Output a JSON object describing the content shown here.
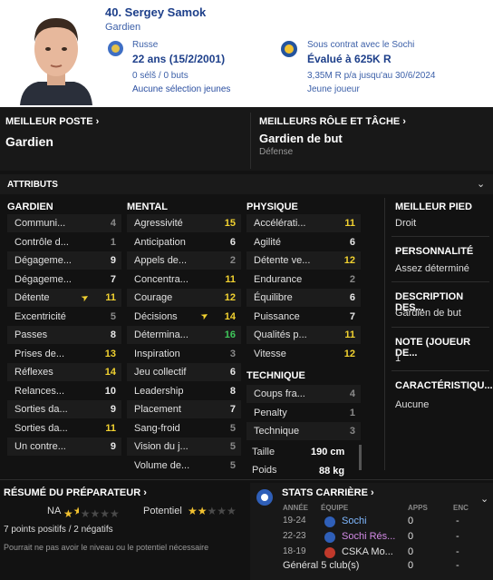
{
  "player": {
    "name": "40. Sergey Samok",
    "position": "Gardien",
    "nationality": "Russe",
    "age": "22 ans (15/2/2001)",
    "selections": "0 sélš / 0 buts",
    "youth": "Aucune sélection jeunes",
    "contract": "Sous contrat avec le Sochi",
    "value": "Évalué à 625K R",
    "wage": "3,35M R p/a jusqu'au 30/6/2024",
    "status": "Jeune joueur"
  },
  "best_position": {
    "label": "MEILLEUR POSTE",
    "value": "Gardien"
  },
  "best_role": {
    "label": "MEILLEURS RÔLE ET TÂCHE",
    "value": "Gardien de but",
    "duty": "Défense"
  },
  "attributes": {
    "title": "ATTRIBUTS",
    "gardien": {
      "title": "GARDIEN",
      "items": [
        {
          "name": "Communi...",
          "value": "4"
        },
        {
          "name": "Contrôle d...",
          "value": "1"
        },
        {
          "name": "Dégageme...",
          "value": "9"
        },
        {
          "name": "Dégageme...",
          "value": "7"
        },
        {
          "name": "Détente",
          "value": "11"
        },
        {
          "name": "Excentricité",
          "value": "5"
        },
        {
          "name": "Passes",
          "value": "8"
        },
        {
          "name": "Prises de...",
          "value": "13"
        },
        {
          "name": "Réflexes",
          "value": "14"
        },
        {
          "name": "Relances...",
          "value": "10"
        },
        {
          "name": "Sorties da...",
          "value": "9"
        },
        {
          "name": "Sorties da...",
          "value": "11"
        },
        {
          "name": "Un contre...",
          "value": "9"
        }
      ]
    },
    "mental": {
      "title": "MENTAL",
      "items": [
        {
          "name": "Agressivité",
          "value": "15"
        },
        {
          "name": "Anticipation",
          "value": "6"
        },
        {
          "name": "Appels de...",
          "value": "2"
        },
        {
          "name": "Concentra...",
          "value": "11"
        },
        {
          "name": "Courage",
          "value": "12"
        },
        {
          "name": "Décisions",
          "value": "14"
        },
        {
          "name": "Détermina...",
          "value": "16"
        },
        {
          "name": "Inspiration",
          "value": "3"
        },
        {
          "name": "Jeu collectif",
          "value": "6"
        },
        {
          "name": "Leadership",
          "value": "8"
        },
        {
          "name": "Placement",
          "value": "7"
        },
        {
          "name": "Sang-froid",
          "value": "5"
        },
        {
          "name": "Vision du j...",
          "value": "5"
        },
        {
          "name": "Volume de...",
          "value": "5"
        }
      ]
    },
    "physique": {
      "title": "PHYSIQUE",
      "items": [
        {
          "name": "Accélérati...",
          "value": "11"
        },
        {
          "name": "Agilité",
          "value": "6"
        },
        {
          "name": "Détente ve...",
          "value": "12"
        },
        {
          "name": "Endurance",
          "value": "2"
        },
        {
          "name": "Équilibre",
          "value": "6"
        },
        {
          "name": "Puissance",
          "value": "7"
        },
        {
          "name": "Qualités p...",
          "value": "11"
        },
        {
          "name": "Vitesse",
          "value": "12"
        }
      ]
    },
    "technique": {
      "title": "TECHNIQUE",
      "items": [
        {
          "name": "Coups fra...",
          "value": "4"
        },
        {
          "name": "Penalty",
          "value": "1"
        },
        {
          "name": "Technique",
          "value": "3"
        }
      ]
    },
    "height_label": "Taille",
    "height": "190 cm",
    "weight_label": "Poids",
    "weight": "88 kg"
  },
  "side": {
    "foot_label": "MEILLEUR PIED",
    "foot": "Droit",
    "pers_label": "PERSONNALITÉ",
    "pers": "Assez déterminé",
    "desc_label": "DESCRIPTION DES...",
    "desc": "Gardien de but",
    "note_label": "NOTE (JOUEUR DE...",
    "note": "1",
    "car_label": "CARACTÉRISTIQU...",
    "car": "Aucune"
  },
  "scout": {
    "title": "RÉSUMÉ DU PRÉPARATEUR",
    "na_label": "NA",
    "potential_label": "Potentiel",
    "points": "7 points positifs / 2 négatifs",
    "note": "Pourrait ne pas avoir le niveau ou le potentiel nécessaire",
    "na_stars": 1.5,
    "potential_stars": 2
  },
  "career": {
    "title": "STATS CARRIÈRE",
    "headers": {
      "year": "ANNÉE",
      "team": "ÉQUIPE",
      "apps": "APPS",
      "enc": "ENC"
    },
    "rows": [
      {
        "year": "19-24",
        "team": "Sochi",
        "apps": "0",
        "enc": "-"
      },
      {
        "year": "22-23",
        "team": "Sochi Rés...",
        "apps": "0",
        "enc": "-"
      },
      {
        "year": "18-19",
        "team": "CSKA Mo...",
        "apps": "0",
        "enc": "-"
      }
    ],
    "total": "Général 5 club(s)",
    "total_apps": "0",
    "total_enc": "-"
  },
  "colors": {
    "header_bg": "#ffffff",
    "dark_bg": "#121212",
    "yellow": "#f2d230",
    "green": "#3fc75a"
  }
}
